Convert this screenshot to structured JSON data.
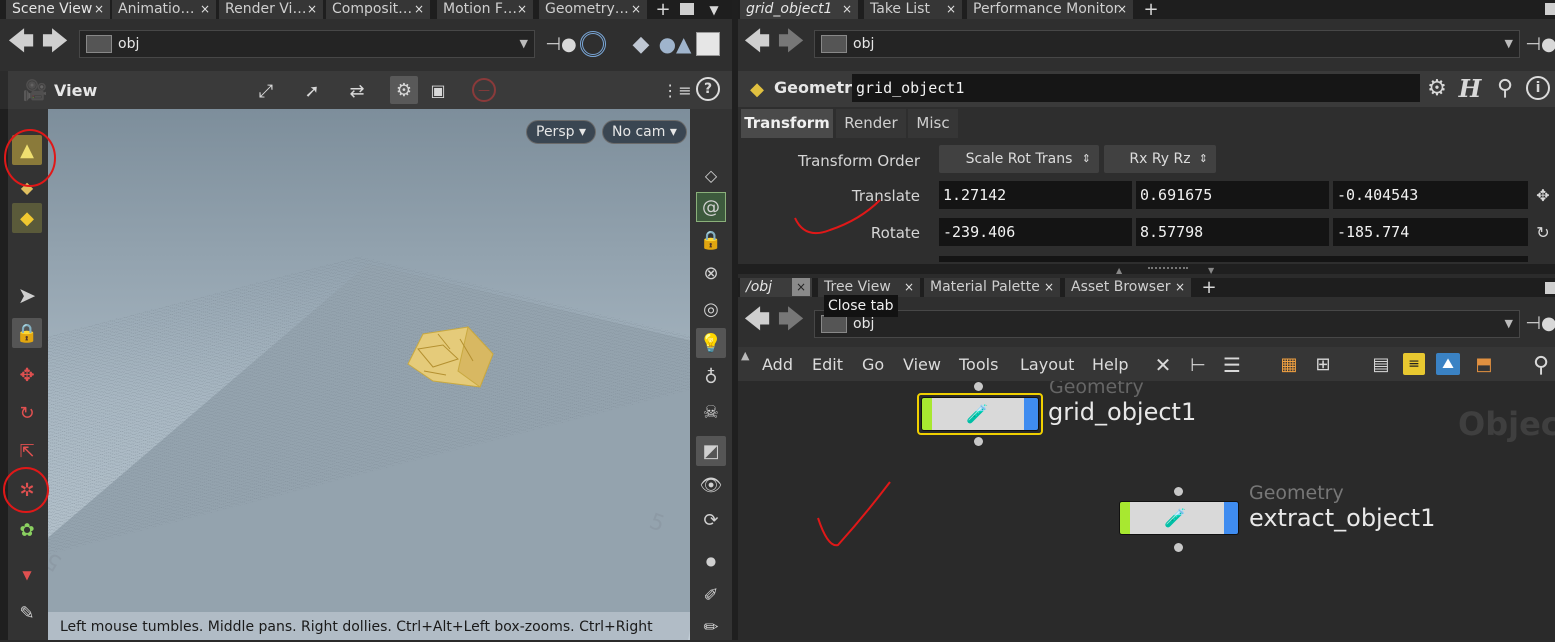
{
  "left_pane": {
    "tabs": [
      {
        "label": "Scene View",
        "close": "×"
      },
      {
        "label": "Animatio…",
        "close": "×"
      },
      {
        "label": "Render Vi…",
        "close": "×"
      },
      {
        "label": "Composit…",
        "close": "×"
      },
      {
        "label": "Motion F…",
        "close": "×"
      },
      {
        "label": "Geometry…",
        "close": "×"
      }
    ],
    "path": "obj",
    "view_label": "View",
    "persp_label": "Persp ▾",
    "cam_label": "No cam ▾",
    "status_text": "Left mouse tumbles. Middle pans. Right dollies. Ctrl+Alt+Left box-zooms. Ctrl+Right",
    "help_icon": "?"
  },
  "right_top": {
    "tabs": [
      {
        "label": "grid_object1",
        "close": "×"
      },
      {
        "label": "Take List",
        "close": "×"
      },
      {
        "label": "Performance Monitor",
        "close": "×"
      }
    ],
    "path": "obj",
    "node_type": "Geometry",
    "node_name": "grid_object1",
    "param_tabs": [
      "Transform",
      "Render",
      "Misc"
    ],
    "transform_order_label": "Transform Order",
    "transform_order_value": "Scale Rot Trans",
    "rotate_order_value": "Rx Ry Rz",
    "translate_label": "Translate",
    "translate": [
      "1.27142",
      "0.691675",
      "-0.404543"
    ],
    "rotate_label": "Rotate",
    "rotate": [
      "-239.406",
      "8.57798",
      "-185.774"
    ],
    "h_icon": "H"
  },
  "right_bottom": {
    "tabs": [
      {
        "label": "/obj",
        "close": "×"
      },
      {
        "label": "Tree View",
        "close": "×"
      },
      {
        "label": "Material Palette",
        "close": "×"
      },
      {
        "label": "Asset Browser",
        "close": "×"
      }
    ],
    "tooltip": "Close tab",
    "path": "obj",
    "menu": [
      "Add",
      "Edit",
      "Go",
      "View",
      "Tools",
      "Layout",
      "Help"
    ],
    "network_label": "Object",
    "nodes": [
      {
        "type": "Geometry",
        "name": "grid_object1"
      },
      {
        "type": "Geometry",
        "name": "extract_object1"
      }
    ]
  },
  "colors": {
    "accent_red_annotation": "#e01818",
    "node_green": "#a8e830",
    "node_blue": "#3f8cf0",
    "selected_yellow": "#f0d000"
  }
}
